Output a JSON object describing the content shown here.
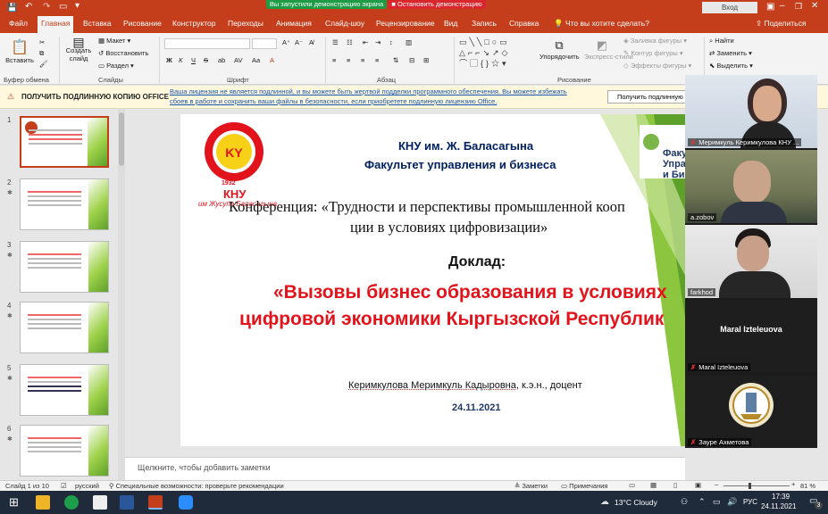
{
  "titlebar": {
    "screen_share_status": "Вы запустили демонстрацию экрана",
    "stop_share_label": "Остановить демонстрацию",
    "login_label": "Вход",
    "accent_color": "#c43e1c"
  },
  "ribbon_tabs": [
    "Файл",
    "Главная",
    "Вставка",
    "Рисование",
    "Конструктор",
    "Переходы",
    "Анимация",
    "Слайд-шоу",
    "Рецензирование",
    "Вид",
    "Запись",
    "Справка"
  ],
  "tell_me": "Что вы хотите сделать?",
  "share_label": "Поделиться",
  "ribbon": {
    "paste": "Вставить",
    "create_slide": "Создать слайд",
    "layout": "Макет",
    "reset": "Восстановить",
    "section": "Раздел",
    "groups": [
      "Буфер обмена",
      "Слайды",
      "Шрифт",
      "Абзац",
      "Рисование"
    ],
    "arrange": "Упорядочить",
    "express_styles": "Экспресс-стили",
    "shape_fill": "Заливка фигуры",
    "shape_outline": "Контур фигуры",
    "shape_effects": "Эффекты фигуры",
    "find": "Найти",
    "replace": "Заменить",
    "select": "Выделить",
    "font_bold": "Ж",
    "font_italic": "К",
    "font_underline": "Ч",
    "font_strike": "S"
  },
  "message_bar": {
    "title": "ПОЛУЧИТЬ ПОДЛИННУЮ КОПИЮ OFFICE",
    "text_line1": "Ваша лицензия не является подлинной, и вы можете быть жертвой подделки программного обеспечения. Вы можете избежать",
    "text_line2": "сбоев в работе и сохранить ваши файлы в безопасности, если приобретете подлинную лицензию Office.",
    "button": "Получить подлинную"
  },
  "slide_numbers": [
    "1",
    "2",
    "3",
    "4",
    "5",
    "6"
  ],
  "slide": {
    "logo_text": "КНУ",
    "logo_subtext": "им Жусупа Баласагына",
    "logo_year": "1932",
    "university": "КНУ им. Ж. Баласагына",
    "faculty": "Факультет управления и бизнеса",
    "conference_line1": "Конференция: «Трудности и перспективы промышленной кооп",
    "conference_line2": "ции в условиях цифровизации»",
    "report_label": "Доклад:",
    "report_title_line1": "«Вызовы бизнес образования в условиях",
    "report_title_line2": "цифровой экономики Кыргызской Республик",
    "author_name": "Керимкулова Меримкуль Кадыровна",
    "author_degree": ", к.э.н., доцент",
    "date": "24.11.2021",
    "corner_text": [
      "Факу",
      "Упра",
      "и Би"
    ]
  },
  "notes_placeholder": "Щелкните, чтобы добавить заметки",
  "statusbar": {
    "slide_info": "Слайд 1 из 10",
    "language": "русский",
    "accessibility": "Специальные возможности: проверьте рекомендации",
    "notes": "Заметки",
    "comments": "Примечания",
    "zoom": "81 %"
  },
  "participants": [
    {
      "name": "Меримкуль Керимкулова КНУ ...",
      "muted": true
    },
    {
      "name": "a.zobov",
      "muted": false
    },
    {
      "name": "farkhod",
      "muted": false
    },
    {
      "name": "Maral Izteleuova",
      "muted": true,
      "video_off": true
    },
    {
      "name": "Зауре Ахметова",
      "muted": true
    }
  ],
  "taskbar": {
    "weather": "13°C  Cloudy",
    "language": "РУС",
    "time": "17:39",
    "date": "24.11.2021",
    "notification_count": "3"
  }
}
